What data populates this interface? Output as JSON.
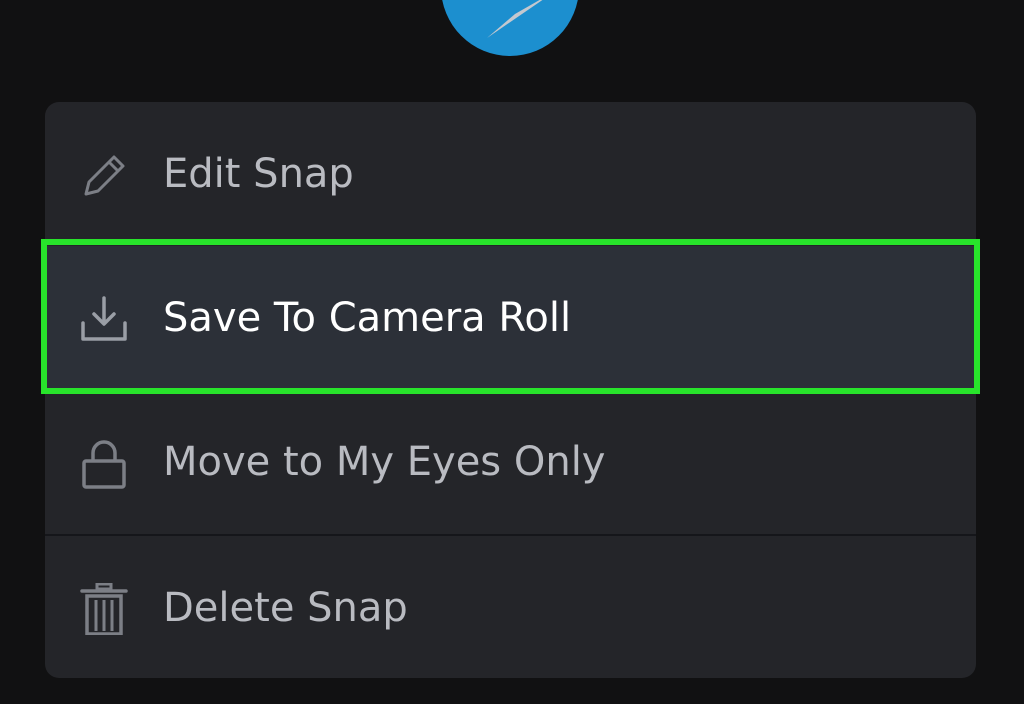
{
  "top_button": {
    "icon": "send-arrow-icon",
    "color": "#1c8fcf"
  },
  "menu": {
    "items": [
      {
        "label": "Edit Snap",
        "icon": "pencil-icon"
      },
      {
        "label": "Save To Camera Roll",
        "icon": "download-icon"
      },
      {
        "label": "Move to My Eyes Only",
        "icon": "lock-icon"
      },
      {
        "label": "Delete Snap",
        "icon": "trash-icon"
      }
    ]
  },
  "highlight": {
    "color": "#28e42b",
    "target": "Save To Camera Roll"
  }
}
